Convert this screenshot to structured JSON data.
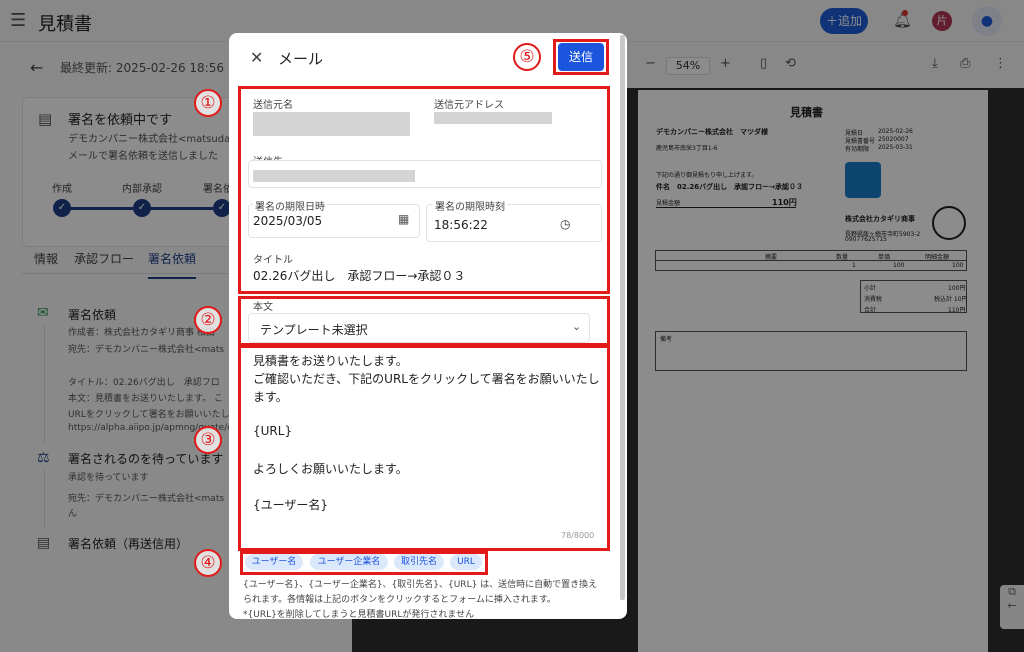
{
  "app": {
    "title": "見積書",
    "add_label": "＋追加",
    "avatar": "片"
  },
  "left": {
    "last_updated": "最終更新: 2025-02-26 18:56",
    "status_title": "署名を依頼中です",
    "status_line1": "デモカンパニー株式会社<matsuda@v",
    "status_line2": "メールで署名依頼を送信しました",
    "steps": [
      "作成",
      "内部承認",
      "署名依"
    ],
    "tabs": [
      "情報",
      "承認フロー",
      "署名依頼"
    ],
    "hist1_title": "署名依頼",
    "hist1_lines": [
      "作成者：株式会社カタギリ商事 松田",
      "宛先：デモカンパニー株式会社<mats",
      "タイトル：02.26バグ出し　承認フロ",
      "本文：見積書をお送りいたします。 こ",
      "URLをクリックして署名をお願いいたし",
      "https://alpha.aiipo.jp/apmng/quote/co"
    ],
    "hist2_title": "署名されるのを待っています",
    "hist2_lines": [
      "承認を待っています",
      "宛先：デモカンパニー株式会社<mats",
      "ん"
    ],
    "hist3_title": "署名依頼（再送信用）"
  },
  "viewer": {
    "zoom": "54%"
  },
  "doc": {
    "title": "見積書",
    "client": "デモカンパニー株式会社　マツダ様",
    "client_addr": "鹿児島市南栄3丁目1-6",
    "meta_labels": [
      "見積日",
      "見積書番号",
      "有効期限"
    ],
    "meta_values": [
      "2025-02-26",
      "25020007",
      "2025-03-31"
    ],
    "intro": "下記の通り御見積もり申し上げます。",
    "subject": "件名　02.26バグ出し　承認フロー→承認０３",
    "total_label": "見積金額",
    "total_value": "110円",
    "company": "株式会社カタギリ商事",
    "company_addr": "長野県飯ヶ梅市寺町5903-2",
    "company_tel": "09077625715",
    "cols": [
      "摘要",
      "数量",
      "単価",
      "明細金額"
    ],
    "row": [
      "",
      "1",
      "100",
      "100"
    ],
    "sum_labels": [
      "小計",
      "消費税",
      "合計"
    ],
    "sum_values": [
      "100円",
      "税込計 10円",
      "110円"
    ],
    "notes_label": "備考"
  },
  "modal": {
    "title": "メール",
    "send_label": "送信",
    "sender_name_label": "送信元名",
    "sender_addr_label": "送信元アドレス",
    "recipient_label": "送信先",
    "deadline_date_label": "署名の期限日時",
    "deadline_date": "2025/03/05",
    "deadline_time_label": "署名の期限時刻",
    "deadline_time": "18:56:22",
    "subject_label": "タイトル",
    "subject": "02.26バグ出し　承認フロー→承認０３",
    "body_label": "本文",
    "template_value": "テンプレート未選択",
    "body_lines": [
      "見積書をお送りいたします。",
      "ご確認いただき、下記のURLをクリックして署名をお願いいたし",
      "ます。",
      "",
      "{URL}",
      "",
      "よろしくお願いいたします。",
      "",
      "{ユーザー名}"
    ],
    "char_count": "78/8000",
    "chips": [
      "ユーザー名",
      "ユーザー企業名",
      "取引先名",
      "URL"
    ],
    "footer_lines": [
      "{ユーザー名}、{ユーザー企業名}、{取引先名}、{URL} は、送信時に自動で置き換え",
      "られます。各情報は上記のボタンをクリックするとフォームに挿入されます。",
      "*{URL}を削除してしまうと見積書URLが発行されません"
    ]
  },
  "annotations": [
    "①",
    "②",
    "③",
    "④",
    "⑤"
  ],
  "colors": {
    "accent": "#1c55dd",
    "annotation": "#e21a1a"
  }
}
